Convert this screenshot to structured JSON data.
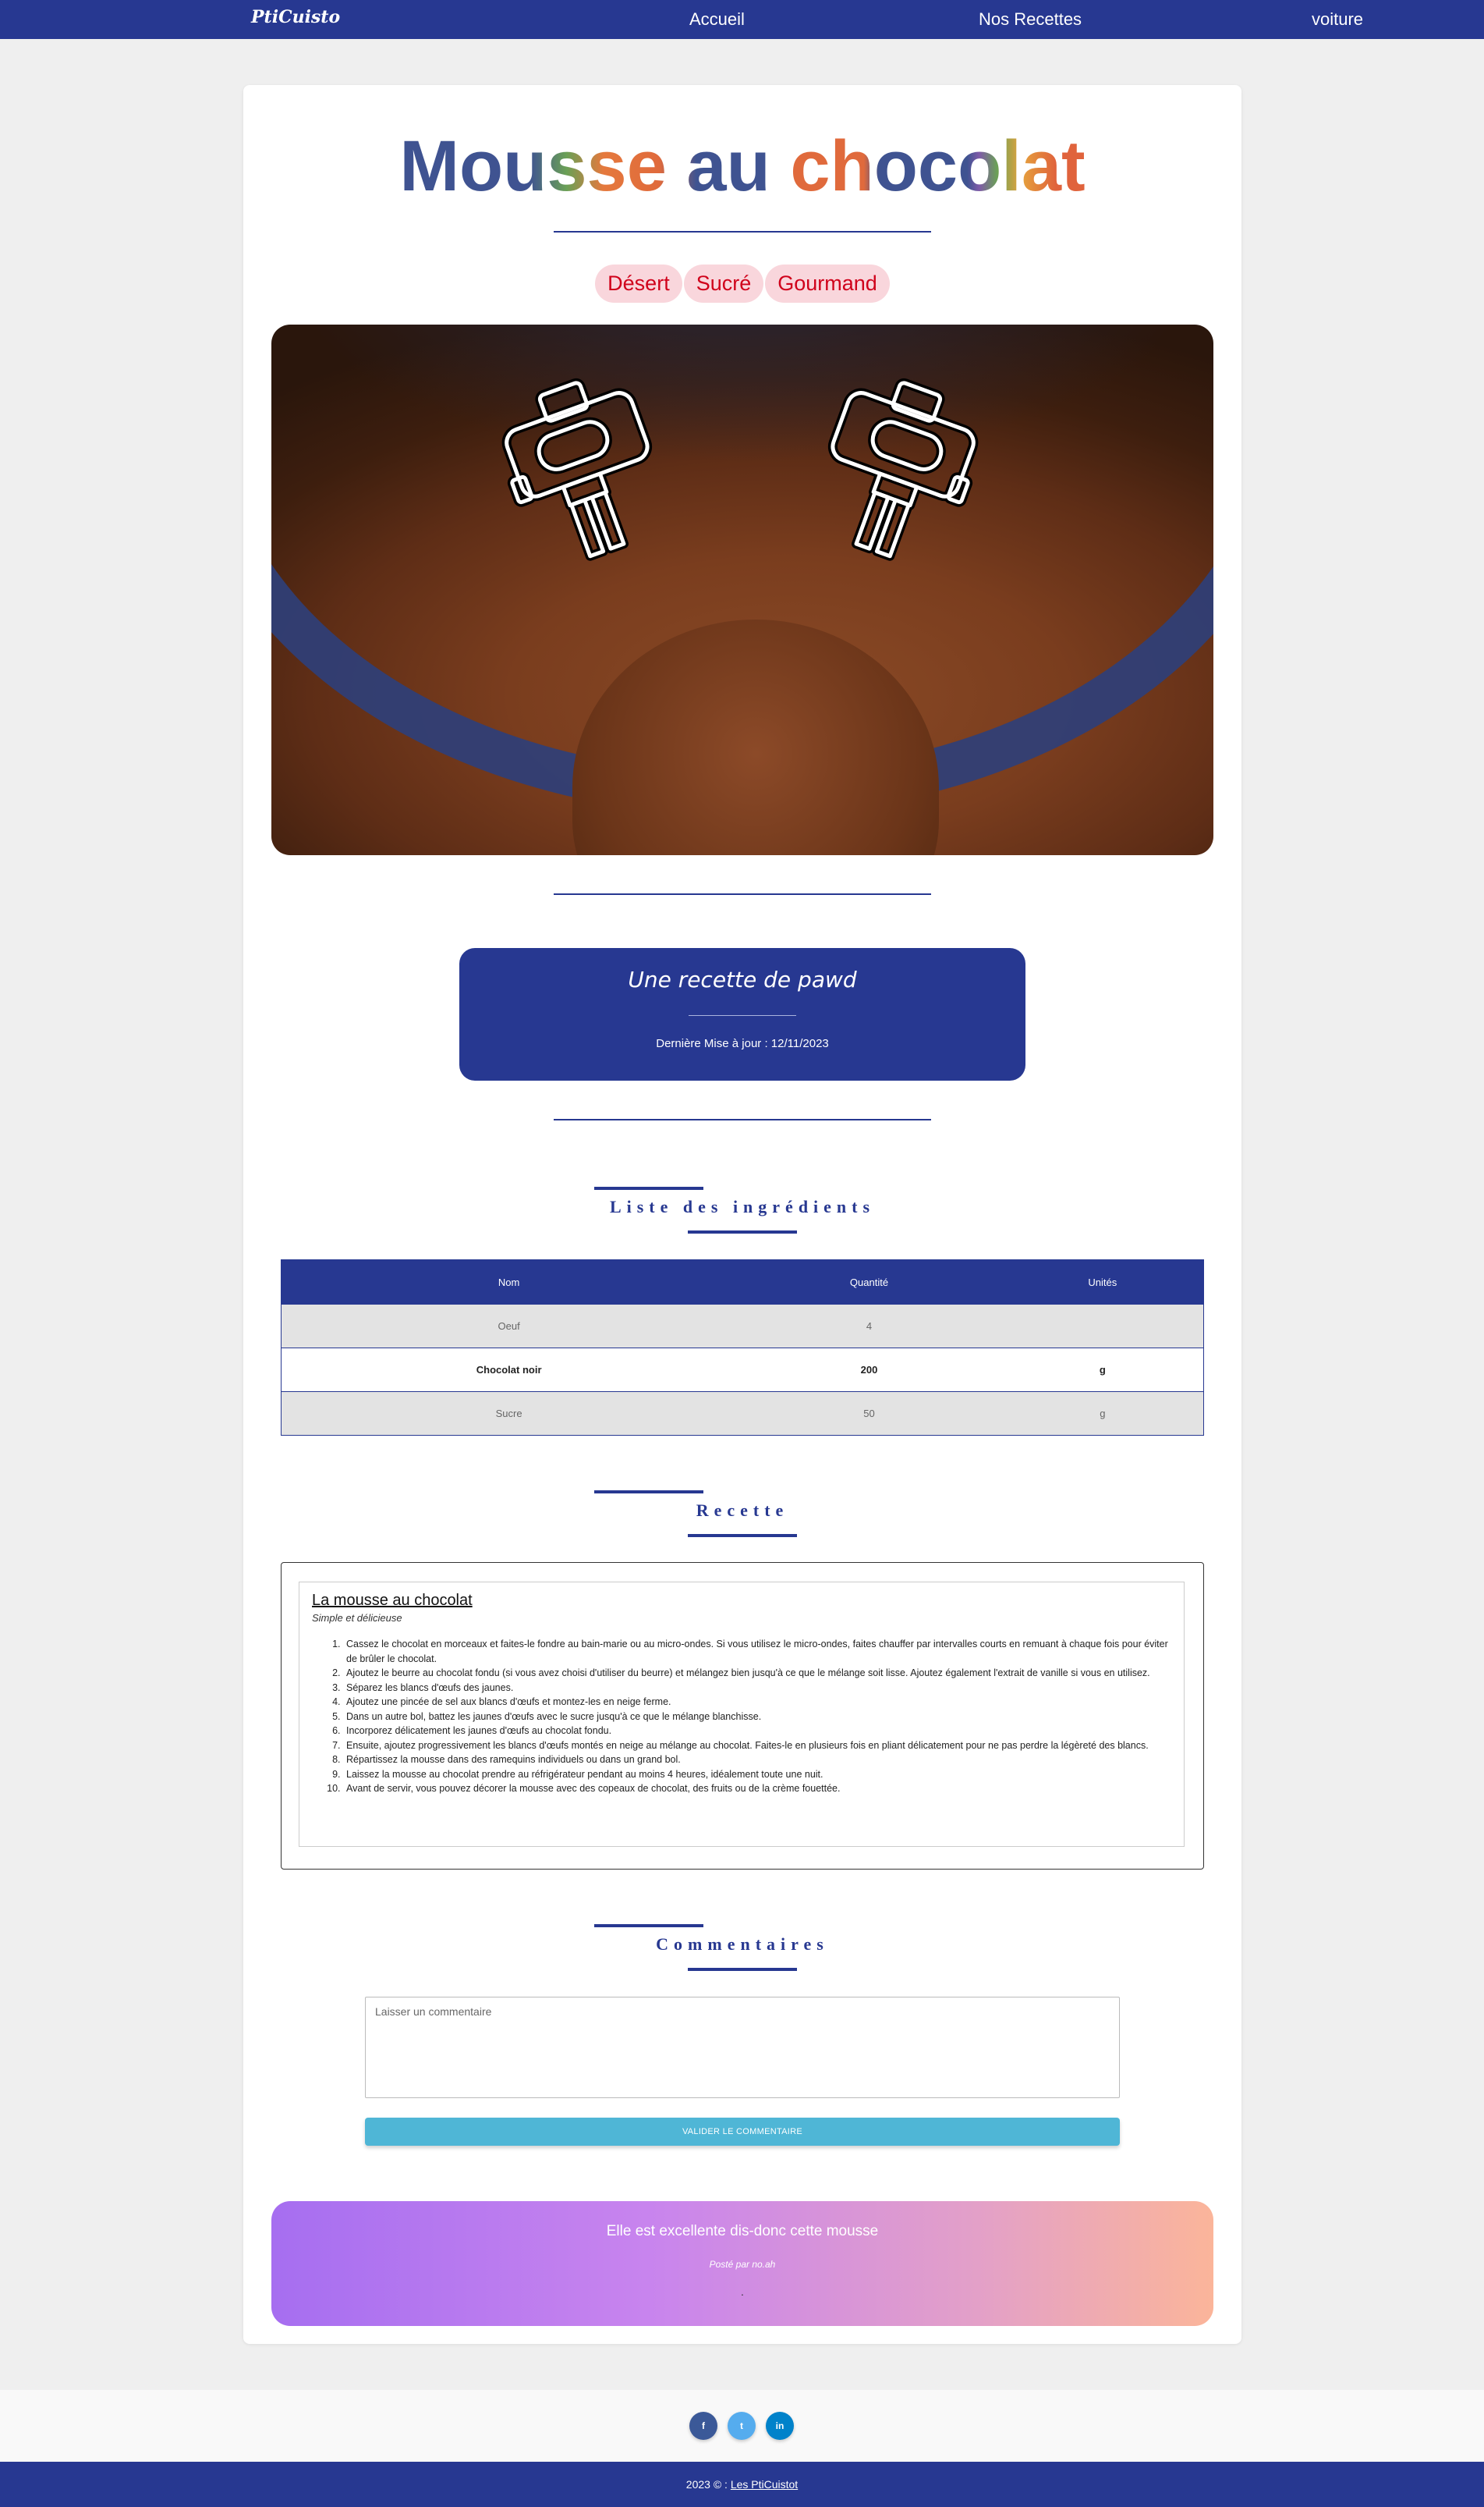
{
  "navbar": {
    "brand": "PtiCuisto",
    "links": [
      "Accueil",
      "Nos Recettes",
      "voiture"
    ]
  },
  "recipe": {
    "title_part1": "Mousse au",
    "title_part2": "chocolat",
    "tags": [
      "Désert",
      "Sucré",
      "Gourmand"
    ],
    "hero_image": "chocolate-mousse-with-mixer-icons",
    "author_line": "Une recette de pawd",
    "updated": "Dernière Mise à jour : 12/11/2023"
  },
  "ingredients": {
    "section_title": "Liste des ingrédients",
    "headers": [
      "Nom",
      "Quantité",
      "Unités"
    ],
    "rows": [
      [
        "Oeuf",
        "4",
        ""
      ],
      [
        "Chocolat noir",
        "200",
        "g"
      ],
      [
        "Sucre",
        "50",
        "g"
      ]
    ]
  },
  "instructions": {
    "section_title": "Recette",
    "heading": "La mousse au chocolat",
    "subheading": "Simple et délicieuse",
    "steps": [
      "Cassez le chocolat en morceaux et faites-le fondre au bain-marie ou au micro-ondes. Si vous utilisez le micro-ondes, faites chauffer par intervalles courts en remuant à chaque fois pour éviter de brûler le chocolat.",
      "Ajoutez le beurre au chocolat fondu (si vous avez choisi d'utiliser du beurre) et mélangez bien jusqu'à ce que le mélange soit lisse. Ajoutez également l'extrait de vanille si vous en utilisez.",
      "Séparez les blancs d'œufs des jaunes.",
      "Ajoutez une pincée de sel aux blancs d'œufs et montez-les en neige ferme.",
      "Dans un autre bol, battez les jaunes d'œufs avec le sucre jusqu'à ce que le mélange blanchisse.",
      "Incorporez délicatement les jaunes d'œufs au chocolat fondu.",
      "Ensuite, ajoutez progressivement les blancs d'œufs montés en neige au mélange au chocolat. Faites-le en plusieurs fois en pliant délicatement pour ne pas perdre la légèreté des blancs.",
      "Répartissez la mousse dans des ramequins individuels ou dans un grand bol.",
      "Laissez la mousse au chocolat prendre au réfrigérateur pendant au moins 4 heures, idéalement toute une nuit.",
      "Avant de servir, vous pouvez décorer la mousse avec des copeaux de chocolat, des fruits ou de la crème fouettée."
    ]
  },
  "comments": {
    "section_title": "Commentaires",
    "placeholder": "Laisser un commentaire",
    "submit_label": "VALIDER LE COMMENTAIRE",
    "items": [
      {
        "text": "Elle est excellente dis-donc cette mousse",
        "meta": "Posté par no.ah",
        "extra": "."
      }
    ]
  },
  "footer": {
    "social": [
      "f",
      "t",
      "in"
    ],
    "copyright": "2023 © :",
    "link": "Les PtiCuistot"
  },
  "colors": {
    "primary": "#273891",
    "tag_bg": "#f9d6dc",
    "tag_text": "#d0021b",
    "button": "#4fb6d6"
  }
}
